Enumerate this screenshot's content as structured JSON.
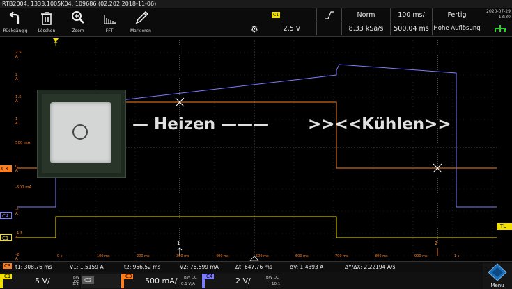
{
  "titlebar": {
    "text": "RTB2004; 1333.1005K04; 109686 (02.202 2018-11-06)"
  },
  "toolbar": {
    "undo_label": "Rückgängig",
    "delete_label": "Löschen",
    "zoom_label": "Zoom",
    "fft_label": "FFT",
    "mark_label": "Markieren"
  },
  "trigger": {
    "source": "C1",
    "level": "2.5 V",
    "mode": "Norm",
    "sample_rate": "8.33 kSa/s",
    "timebase": "100 ms/",
    "position": "500.04 ms",
    "acq_state": "Fertig",
    "acq_mode": "Hohe Auflösung"
  },
  "datetime": {
    "date": "2020-07-29",
    "time": "13:30"
  },
  "axis": {
    "y_labels": [
      "2.5 A",
      "2 A",
      "1.5 A",
      "1 A",
      "500 mA",
      "0 A",
      "-500 mA",
      "-1 A",
      "-1.5 A",
      "-2 A"
    ],
    "x_labels": [
      "0 s",
      "100 ms",
      "200 ms",
      "300 ms",
      "400 ms",
      "500 ms",
      "600 ms",
      "700 ms",
      "800 ms",
      "900 ms",
      "1 s"
    ]
  },
  "channels": {
    "c3_marker": "C3",
    "c4_marker": "C4",
    "c1_marker": "C1",
    "tl_marker": "TL",
    "c3_color": "#ff7f1e",
    "c4_color": "#7c7cff",
    "c1_color": "#f2e100"
  },
  "overlay": {
    "heating_text": "— Heizen ———",
    "cooling_text": ">><<Kühlen>>"
  },
  "cursors": {
    "c1_label": "1",
    "c2_label": "2"
  },
  "measure": {
    "badge": "C3",
    "t1": "t1: 308.76 ms",
    "v1": "V1: 1.5159 A",
    "t2": "t2: 956.52 ms",
    "v2": "V2: 76.599 mA",
    "dt": "Δt: 647.76 ms",
    "dv": "ΔV: 1.4393 A",
    "dydx": "ΔY/ΔX: 2.22194 A/s"
  },
  "chanbar": {
    "c1": {
      "name": "C1",
      "scale": "5 V/",
      "coupling": "DC",
      "probe": "1:1"
    },
    "c2": {
      "name": "C2"
    },
    "c3": {
      "name": "C3",
      "scale": "500 mA/",
      "coupling": "DC",
      "probe": "0.1 V/A"
    },
    "c4": {
      "name": "C4",
      "scale": "2 V/",
      "coupling": "DC",
      "probe": "10:1"
    },
    "bw_label": "BW"
  },
  "menu": {
    "label": "Menu"
  }
}
